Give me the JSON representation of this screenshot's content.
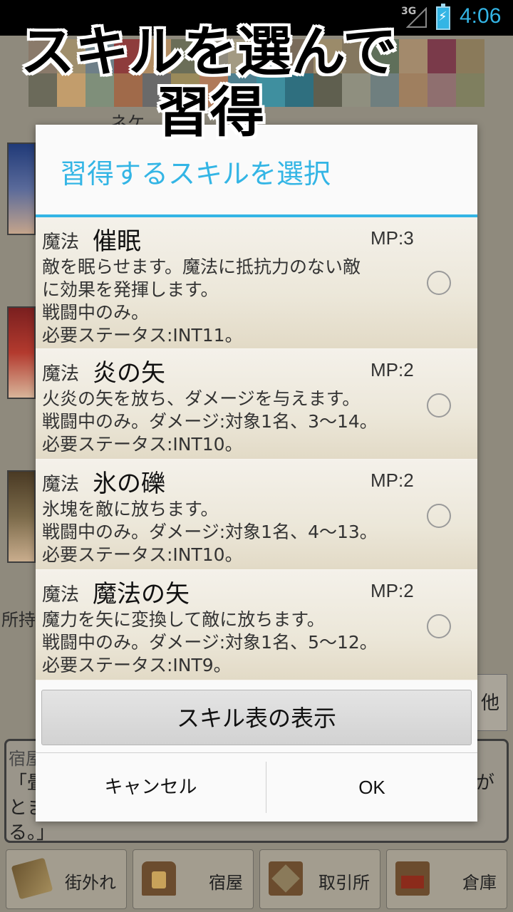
{
  "status_bar": {
    "network": "3G",
    "time": "4:06"
  },
  "caption": {
    "line1": "スキルを選んで",
    "line2": "習得"
  },
  "background": {
    "name_partial": "ネケ",
    "shojikin_partial": "所持",
    "sono_partial": "他",
    "message": {
      "speaker_partial": "宿屋",
      "line1_partial": "「畳",
      "line2_partial": "とま",
      "line3": "る。」",
      "right_partial": "が"
    },
    "nav": [
      {
        "label": "街外れ",
        "icon": "signpost-icon"
      },
      {
        "label": "宿屋",
        "icon": "inn-icon"
      },
      {
        "label": "取引所",
        "icon": "trade-icon"
      },
      {
        "label": "倉庫",
        "icon": "storehouse-icon"
      }
    ]
  },
  "dialog": {
    "title": "習得するスキルを選択",
    "skills": [
      {
        "category": "魔法",
        "name": "催眠",
        "mp": "MP:3",
        "lines": [
          "敵を眠らせます。魔法に抵抗力のない敵",
          "に効果を発揮します。",
          "戦闘中のみ。",
          "必要ステータス:INT11。"
        ]
      },
      {
        "category": "魔法",
        "name": "炎の矢",
        "mp": "MP:2",
        "lines": [
          "火炎の矢を放ち、ダメージを与えます。",
          "戦闘中のみ。ダメージ:対象1名、3～14。",
          "必要ステータス:INT10。"
        ]
      },
      {
        "category": "魔法",
        "name": "氷の礫",
        "mp": "MP:2",
        "lines": [
          "氷塊を敵に放ちます。",
          "戦闘中のみ。ダメージ:対象1名、4～13。",
          "必要ステータス:INT10。"
        ]
      },
      {
        "category": "魔法",
        "name": "魔法の矢",
        "mp": "MP:2",
        "lines": [
          "魔力を矢に変換して敵に放ちます。",
          "戦闘中のみ。ダメージ:対象1名、5～12。",
          "必要ステータス:INT9。"
        ]
      }
    ],
    "table_button": "スキル表の表示",
    "cancel": "キャンセル",
    "ok": "OK"
  },
  "colors": {
    "accent": "#33b5e5",
    "status_bar": "#000000",
    "dialog_bg": "#fafafa"
  }
}
